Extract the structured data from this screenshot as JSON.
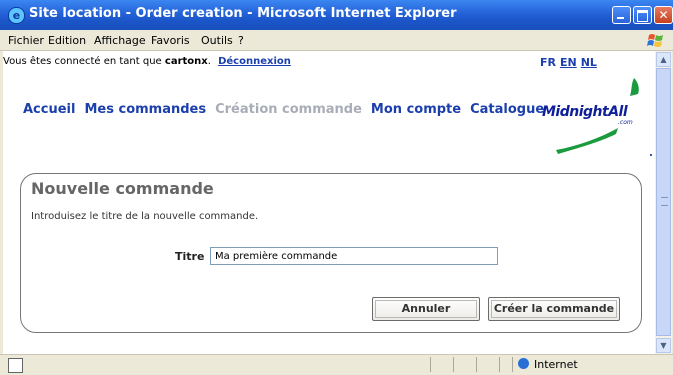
{
  "window": {
    "title": "Site location - Order creation - Microsoft Internet Explorer"
  },
  "menu": [
    "Fichier",
    "Edition",
    "Affichage",
    "Favoris",
    "Outils",
    "?"
  ],
  "page": {
    "login_prefix": "Vous êtes connecté en tant que",
    "username": "cartonx",
    "logout": "Déconnexion",
    "languages": {
      "current": "FR",
      "links": [
        "EN",
        "NL"
      ]
    },
    "nav": [
      {
        "label": "Accueil",
        "active": false
      },
      {
        "label": "Mes commandes",
        "active": false
      },
      {
        "label": "Création commande",
        "active": true
      },
      {
        "label": "Mon compte",
        "active": false
      },
      {
        "label": "Catalogue",
        "active": false
      }
    ],
    "logo_text": "MidnightAll",
    "logo_suffix": ".com"
  },
  "form": {
    "title": "Nouvelle commande",
    "description": "Introduisez le titre de la nouvelle commande.",
    "field_label": "Titre",
    "field_value": "Ma première commande",
    "cancel_label": "Annuler",
    "submit_label": "Créer la commande"
  },
  "statusbar": {
    "zone": "Internet"
  },
  "colors": {
    "link": "#1c3fae",
    "inactive_nav": "#a9adb7",
    "titlebar": "#2462d8",
    "logo_green": "#1a9b3e"
  }
}
